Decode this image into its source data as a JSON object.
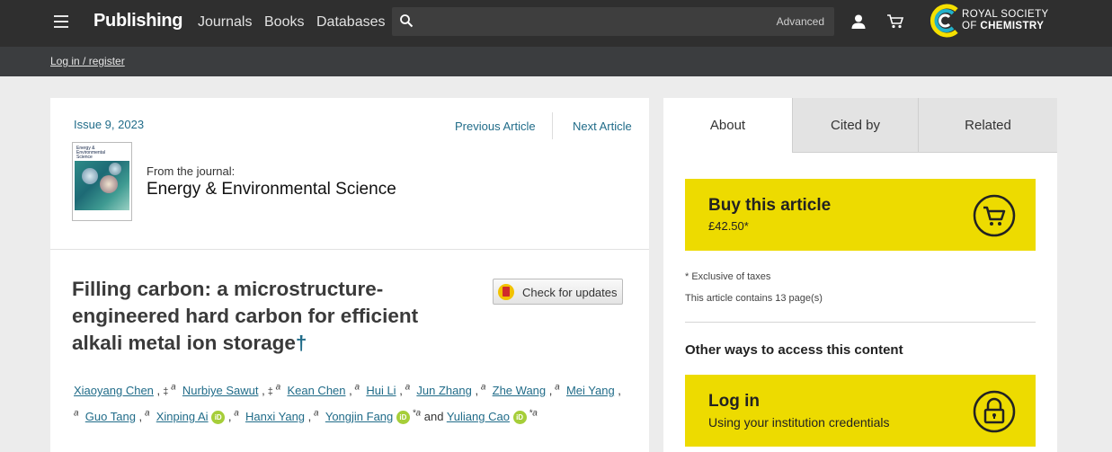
{
  "topbar": {
    "brand": "Publishing",
    "nav": [
      "Journals",
      "Books",
      "Databases"
    ],
    "search_placeholder": "",
    "advanced": "Advanced",
    "rsc_line1": "ROYAL SOCIETY",
    "rsc_line2_prefix": "OF ",
    "rsc_line2_bold": "CHEMISTRY"
  },
  "subbar": {
    "login": "Log in / register"
  },
  "article": {
    "issue": "Issue 9, 2023",
    "prev": "Previous Article",
    "next": "Next Article",
    "from_journal": "From the journal:",
    "journal": "Energy & Environmental Science",
    "cover_text": "Energy & Environmental Science",
    "title": "Filling carbon: a microstructure-engineered hard carbon for efficient alkali metal ion storage",
    "dagger": "†",
    "check_updates": "Check for updates",
    "authors": [
      {
        "name": "Xiaoyang Chen",
        "sep": ",",
        "mark": "‡",
        "aff": "a",
        "orcid": false,
        "star": false,
        "tail": ""
      },
      {
        "name": "Nurbiye Sawut",
        "sep": ",",
        "mark": "‡",
        "aff": "a",
        "orcid": false,
        "star": false,
        "tail": ""
      },
      {
        "name": "Kean Chen",
        "sep": ",",
        "mark": "",
        "aff": "a",
        "orcid": false,
        "star": false,
        "tail": ""
      },
      {
        "name": "Hui Li",
        "sep": ",",
        "mark": "",
        "aff": "a",
        "orcid": false,
        "star": false,
        "tail": ""
      },
      {
        "name": "Jun Zhang",
        "sep": ",",
        "mark": "",
        "aff": "a",
        "orcid": false,
        "star": false,
        "tail": ""
      },
      {
        "name": "Zhe Wang",
        "sep": ",",
        "mark": "",
        "aff": "a",
        "orcid": false,
        "star": false,
        "tail": ""
      },
      {
        "name": "Mei Yang",
        "sep": ",",
        "mark": "",
        "aff": "a",
        "orcid": false,
        "star": false,
        "tail": ""
      },
      {
        "name": "Guo Tang",
        "sep": ",",
        "mark": "",
        "aff": "a",
        "orcid": false,
        "star": false,
        "tail": ""
      },
      {
        "name": "Xinping Ai",
        "sep": ",",
        "mark": "",
        "aff": "a",
        "orcid": true,
        "star": false,
        "tail": ""
      },
      {
        "name": "Hanxi Yang",
        "sep": ",",
        "mark": "",
        "aff": "a",
        "orcid": false,
        "star": false,
        "tail": ""
      },
      {
        "name": "Yongjin Fang",
        "sep": "",
        "mark": "",
        "aff": "a",
        "orcid": true,
        "star": true,
        "tail": " and "
      },
      {
        "name": "Yuliang Cao",
        "sep": "",
        "mark": "",
        "aff": "a",
        "orcid": true,
        "star": true,
        "tail": ""
      }
    ],
    "orcid_label": "iD"
  },
  "sidebar": {
    "tabs": [
      "About",
      "Cited by",
      "Related"
    ],
    "buy_title": "Buy this article",
    "buy_price": "£42.50*",
    "exclusive": "* Exclusive of taxes",
    "pages": "This article contains 13 page(s)",
    "other_ways": "Other ways to access this content",
    "login_title": "Log in",
    "login_sub": "Using your institution credentials"
  },
  "colors": {
    "accent": "#216c89",
    "yellow": "#eddb00",
    "header": "#2f2f2f",
    "orcid": "#a6ce39"
  }
}
